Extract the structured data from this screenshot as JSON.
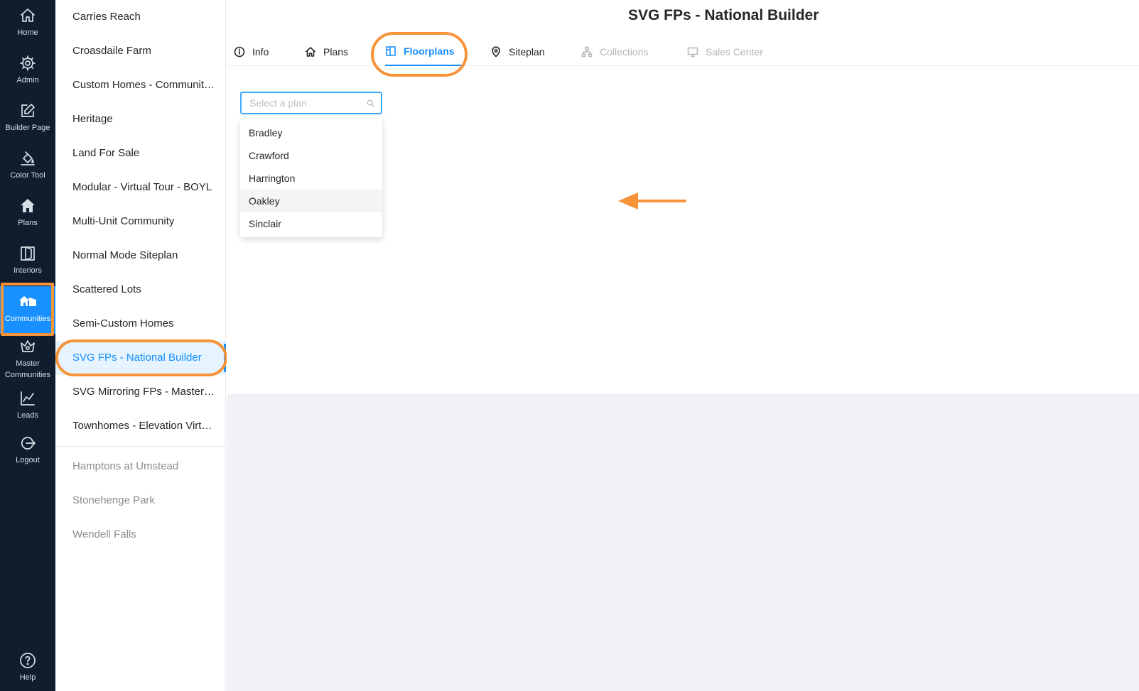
{
  "rail": {
    "items": [
      {
        "label": "Home",
        "icon": "home-icon"
      },
      {
        "label": "Admin",
        "icon": "gear-icon"
      },
      {
        "label": "Builder Page",
        "icon": "edit-icon"
      },
      {
        "label": "Color Tool",
        "icon": "paint-bucket-icon"
      },
      {
        "label": "Plans",
        "icon": "house-filled-icon"
      },
      {
        "label": "Interiors",
        "icon": "door-icon"
      },
      {
        "label": "Communities",
        "icon": "communities-icon"
      },
      {
        "label": "Master Communities",
        "icon": "crown-icon"
      },
      {
        "label": "Leads",
        "icon": "chart-icon"
      },
      {
        "label": "Logout",
        "icon": "logout-icon"
      },
      {
        "label": "Help",
        "icon": "help-icon"
      }
    ]
  },
  "communities": {
    "items": [
      "Carries Reach",
      "Croasdaile Farm",
      "Custom Homes - Community Template",
      "Heritage",
      "Land For Sale",
      "Modular - Virtual Tour - BOYL",
      "Multi-Unit Community",
      "Normal Mode Siteplan",
      "Scattered Lots",
      "Semi-Custom Homes",
      "SVG FPs - National Builder",
      "SVG Mirroring FPs - Master Community",
      "Townhomes - Elevation Virtual Tours"
    ],
    "inactive_items": [
      "Hamptons at Umstead",
      "Stonehenge Park",
      "Wendell Falls"
    ],
    "selected": "SVG FPs - National Builder"
  },
  "page": {
    "title": "SVG FPs - National Builder"
  },
  "tabs": [
    {
      "label": "Info",
      "icon": "info-icon"
    },
    {
      "label": "Plans",
      "icon": "home-icon"
    },
    {
      "label": "Floorplans",
      "icon": "layout-icon"
    },
    {
      "label": "Siteplan",
      "icon": "map-pin-icon"
    },
    {
      "label": "Collections",
      "icon": "hierarchy-icon"
    },
    {
      "label": "Sales Center",
      "icon": "monitor-icon"
    }
  ],
  "plan_select": {
    "placeholder": "Select a plan",
    "options": [
      "Bradley",
      "Crawford",
      "Harrington",
      "Oakley",
      "Sinclair"
    ],
    "hovered": "Oakley"
  },
  "colors": {
    "rail_bg": "#0f1d2e",
    "accent": "#1890ff",
    "highlight": "#f7943a"
  }
}
